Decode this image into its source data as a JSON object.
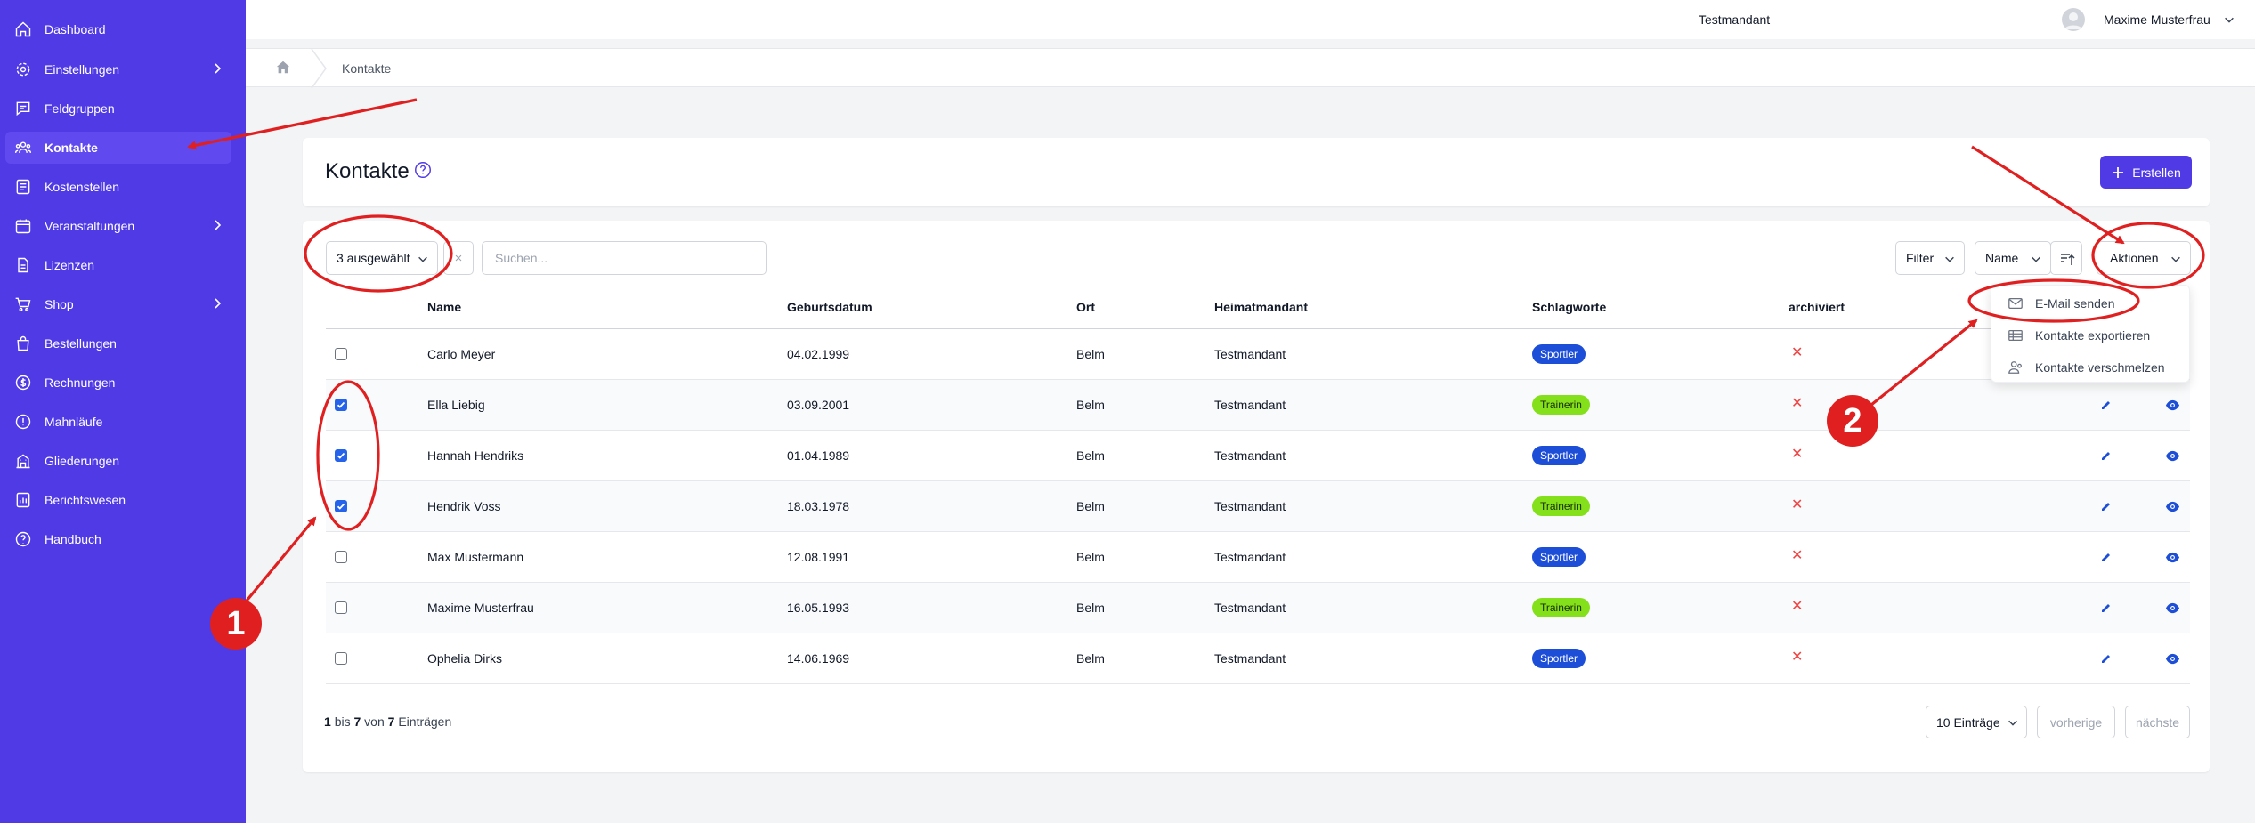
{
  "sidebar": {
    "items": [
      {
        "label": "Dashboard",
        "icon": "home-icon",
        "expandable": false,
        "active": false
      },
      {
        "label": "Einstellungen",
        "icon": "gear-icon",
        "expandable": true,
        "active": false
      },
      {
        "label": "Feldgruppen",
        "icon": "chat-icon",
        "expandable": false,
        "active": false
      },
      {
        "label": "Kontakte",
        "icon": "users-icon",
        "expandable": false,
        "active": true
      },
      {
        "label": "Kostenstellen",
        "icon": "ledger-icon",
        "expandable": false,
        "active": false
      },
      {
        "label": "Veranstaltungen",
        "icon": "calendar-icon",
        "expandable": true,
        "active": false
      },
      {
        "label": "Lizenzen",
        "icon": "document-icon",
        "expandable": false,
        "active": false
      },
      {
        "label": "Shop",
        "icon": "cart-icon",
        "expandable": true,
        "active": false
      },
      {
        "label": "Bestellungen",
        "icon": "bag-icon",
        "expandable": false,
        "active": false
      },
      {
        "label": "Rechnungen",
        "icon": "currency-icon",
        "expandable": false,
        "active": false
      },
      {
        "label": "Mahnläufe",
        "icon": "alert-icon",
        "expandable": false,
        "active": false
      },
      {
        "label": "Gliederungen",
        "icon": "building-icon",
        "expandable": false,
        "active": false
      },
      {
        "label": "Berichtswesen",
        "icon": "report-icon",
        "expandable": false,
        "active": false
      },
      {
        "label": "Handbuch",
        "icon": "help-icon",
        "expandable": false,
        "active": false
      }
    ]
  },
  "topbar": {
    "tenant": "Testmandant",
    "user_name": "Maxime Musterfrau"
  },
  "breadcrumb": {
    "current": "Kontakte"
  },
  "page": {
    "title": "Kontakte",
    "create_label": "Erstellen"
  },
  "toolbar": {
    "selection_label": "3 ausgewählt",
    "clear_label": "×",
    "search_placeholder": "Suchen...",
    "filter_label": "Filter",
    "sort_field": "Name",
    "actions_label": "Aktionen"
  },
  "actions_menu": {
    "items": [
      {
        "label": "E-Mail senden",
        "icon": "mail-icon"
      },
      {
        "label": "Kontakte exportieren",
        "icon": "table-icon"
      },
      {
        "label": "Kontakte verschmelzen",
        "icon": "merge-users-icon"
      }
    ]
  },
  "table": {
    "columns": [
      "Name",
      "Geburtsdatum",
      "Ort",
      "Heimatmandant",
      "Schlagworte",
      "archiviert"
    ],
    "rows": [
      {
        "checked": false,
        "name": "Carlo Meyer",
        "birth": "04.02.1999",
        "city": "Belm",
        "tenant": "Testmandant",
        "tag": "Sportler",
        "archived": "✕"
      },
      {
        "checked": true,
        "name": "Ella Liebig",
        "birth": "03.09.2001",
        "city": "Belm",
        "tenant": "Testmandant",
        "tag": "Trainerin",
        "archived": "✕"
      },
      {
        "checked": true,
        "name": "Hannah Hendriks",
        "birth": "01.04.1989",
        "city": "Belm",
        "tenant": "Testmandant",
        "tag": "Sportler",
        "archived": "✕"
      },
      {
        "checked": true,
        "name": "Hendrik Voss",
        "birth": "18.03.1978",
        "city": "Belm",
        "tenant": "Testmandant",
        "tag": "Trainerin",
        "archived": "✕"
      },
      {
        "checked": false,
        "name": "Max Mustermann",
        "birth": "12.08.1991",
        "city": "Belm",
        "tenant": "Testmandant",
        "tag": "Sportler",
        "archived": "✕"
      },
      {
        "checked": false,
        "name": "Maxime Musterfrau",
        "birth": "16.05.1993",
        "city": "Belm",
        "tenant": "Testmandant",
        "tag": "Trainerin",
        "archived": "✕"
      },
      {
        "checked": false,
        "name": "Ophelia Dirks",
        "birth": "14.06.1969",
        "city": "Belm",
        "tenant": "Testmandant",
        "tag": "Sportler",
        "archived": "✕"
      }
    ]
  },
  "footer": {
    "from": "1",
    "between": "bis",
    "to": "7",
    "of": "von",
    "total": "7",
    "suffix": "Einträgen",
    "page_size": "10 Einträge",
    "prev_label": "vorherige",
    "next_label": "nächste"
  },
  "annotations": {
    "badge_1": "1",
    "badge_2": "2"
  },
  "colors": {
    "sidebar": "#4f3ae6",
    "accent": "#4f3ae6",
    "tag_sportler": "#1d4ed8",
    "tag_trainerin": "#84e01b",
    "annotation": "#e02020",
    "archived_x": "#ef4444"
  }
}
